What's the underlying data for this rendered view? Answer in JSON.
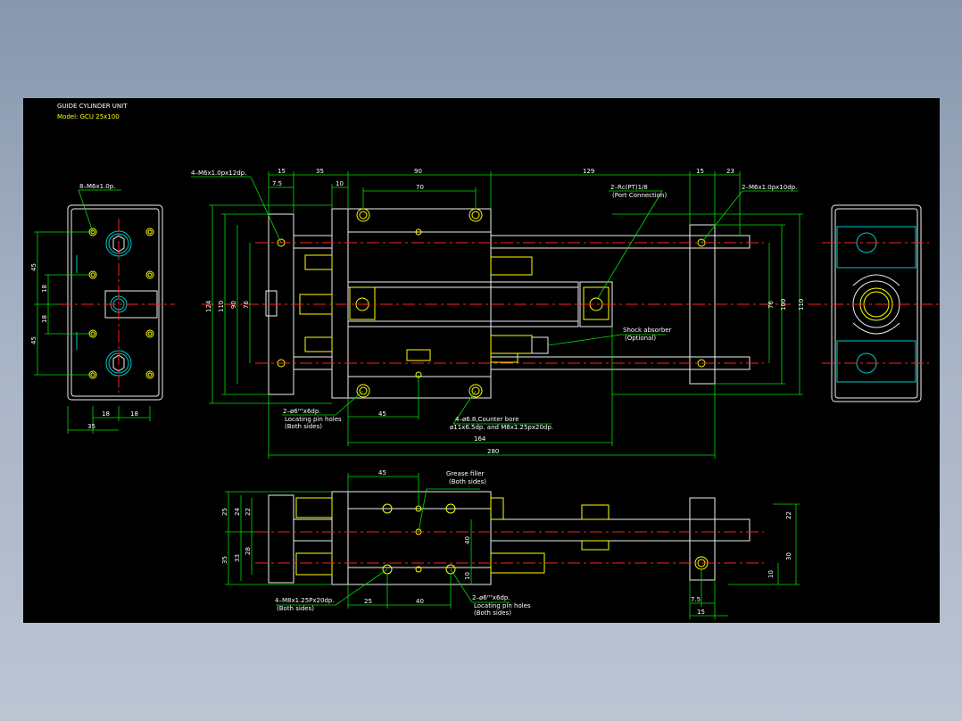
{
  "title": {
    "line1": "GUIDE CYLINDER UNIT",
    "line2": "Model: GCU 25x100"
  },
  "colors": {
    "background": "#000000",
    "dimension": "#00e000",
    "outline": "#f0f0f0",
    "hidden": "#ffff00",
    "cyan": "#00c8c8",
    "centerline": "#ff2020",
    "frame": "#a9b4c6"
  },
  "top_view": {
    "dims_top": {
      "d15a": "15",
      "d35": "35",
      "d90": "90",
      "d129": "129",
      "d15b": "15",
      "d23": "23",
      "d7_5": "7.5",
      "d10": "10",
      "d70": "70"
    },
    "dims_left": {
      "d124": "124",
      "d110": "110",
      "d90": "90",
      "d76": "76"
    },
    "dims_right": {
      "d76": "76",
      "d100": "100",
      "d110": "110"
    },
    "dims_bottom": {
      "d45": "45",
      "d164": "164",
      "d280": "280"
    },
    "callouts": {
      "m6x12": "4–M6x1.0px12dp.",
      "rc": "2–Rc(PT)1/8",
      "rc_sub": "(Port Connection)",
      "m6x10": "2–M6x1.0px10dp.",
      "shock": "Shock absorber",
      "shock_sub": "(Optional)",
      "pin": "2–ø6ᴴ⁷x6dp.",
      "pin_sub1": "Locating pin holes",
      "pin_sub2": "(Both sides)",
      "cbore": "4–ø6.8,Counter bore",
      "cbore_sub": "ø11x6.5dp. and M8x1.25px20dp."
    }
  },
  "left_view": {
    "callout": "8–M6x1.0p.",
    "dims_left": [
      "45",
      "18",
      "18",
      "45"
    ],
    "dims_bottom": [
      "18",
      "18",
      "35"
    ]
  },
  "front_view": {
    "dims_top": {
      "d45": "45"
    },
    "dims_left_outer": [
      "25",
      "35"
    ],
    "dims_left_inner": [
      "24",
      "22",
      "28",
      "33"
    ],
    "dims_mid": [
      "40",
      "10"
    ],
    "dims_right": [
      "22",
      "30",
      "10"
    ],
    "dims_bottom": [
      "25",
      "40",
      "7.5",
      "15"
    ],
    "callouts": {
      "grease": "Grease filler",
      "grease_sub": "(Both sides)",
      "m8": "4–M8x1.25Px20dp.",
      "m8_sub": "(Both sides)",
      "pin": "2–ø6ᴴ⁷x6dp.",
      "pin_sub1": "Locating pin holes",
      "pin_sub2": "(Both sides)"
    }
  }
}
